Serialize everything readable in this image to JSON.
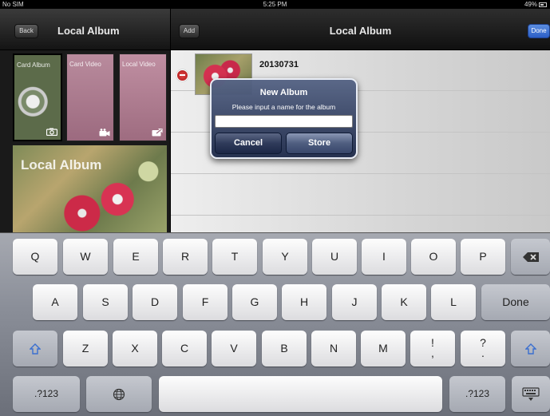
{
  "status_bar": {
    "carrier": "No SIM",
    "time": "5:25 PM",
    "battery": "49%"
  },
  "left_panel": {
    "back_label": "Back",
    "title": "Local Album",
    "thumbnails": [
      {
        "label": "Card Album",
        "icon": "camera-icon"
      },
      {
        "label": "Card Video",
        "icon": "video-camera-icon"
      },
      {
        "label": "Local Video",
        "icon": "video-export-icon"
      }
    ],
    "big_thumbnail_label": "Local Album"
  },
  "right_panel": {
    "add_label": "Add",
    "title": "Local Album",
    "done_label": "Done",
    "rows": [
      {
        "title": "20130731"
      }
    ]
  },
  "alert": {
    "title": "New Album",
    "message": "Please input a name for the album",
    "input_value": "",
    "cancel_label": "Cancel",
    "store_label": "Store"
  },
  "keyboard": {
    "row1": [
      "Q",
      "W",
      "E",
      "R",
      "T",
      "Y",
      "U",
      "I",
      "O",
      "P"
    ],
    "row2": [
      "A",
      "S",
      "D",
      "F",
      "G",
      "H",
      "J",
      "K",
      "L"
    ],
    "return_label": "Done",
    "row3": [
      "Z",
      "X",
      "C",
      "V",
      "B",
      "N",
      "M"
    ],
    "exclaim_top": "!",
    "exclaim_bottom": ",",
    "question_top": "?",
    "question_bottom": ".",
    "numbers_label": ".?123",
    "numbers_label_right": ".?123"
  }
}
